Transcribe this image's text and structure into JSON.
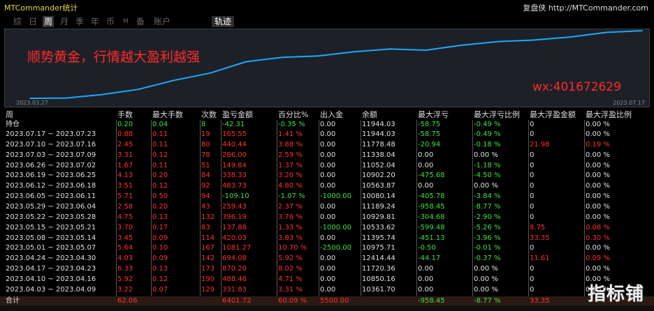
{
  "app_title": "MTCommander统计",
  "brand_right": "复盘侠 http://MTCommander.com",
  "tabs": [
    "综",
    "日",
    "周",
    "月",
    "季",
    "年",
    "币",
    "M",
    "备",
    "账户"
  ],
  "active_tab": "周",
  "trade_tab": "轨迹",
  "chart": {
    "slogan": "顺势黄金，行情越大盈利越强",
    "wx": "wx:401672629",
    "date_start": "2023.03.27",
    "date_end": "2023.07.17",
    "line_color": "#1ea7ff"
  },
  "chart_data": {
    "type": "line",
    "x": [
      "2023.03.27",
      "2023.04.03",
      "2023.04.10",
      "2023.04.17",
      "2023.04.24",
      "2023.05.01",
      "2023.05.08",
      "2023.05.15",
      "2023.05.22",
      "2023.05.29",
      "2023.06.05",
      "2023.06.12",
      "2023.06.19",
      "2023.06.26",
      "2023.07.03",
      "2023.07.10",
      "2023.07.17"
    ],
    "values": [
      10000.0,
      10029.87,
      10361.7,
      10850.16,
      11720.36,
      12414.44,
      10975.71,
      11395.74,
      10533.62,
      10929.81,
      11189.24,
      10080.14,
      10563.87,
      10902.2,
      11052.04,
      11338.04,
      11778.48
    ],
    "xlabel": "",
    "ylabel": ""
  },
  "table": {
    "headers": [
      "周",
      "手数",
      "最大手数",
      "次数",
      "盈亏金额",
      "百分比%",
      "出入金",
      "余额",
      "最大浮亏",
      "最大浮亏比例",
      "最大浮盈金额",
      "最大浮盈比例"
    ],
    "open": [
      "持仓",
      "0.20",
      "0.04",
      "8",
      "-42.31",
      "-0.35 %",
      "0.00",
      "11944.03",
      "-58.75",
      "-0.49 %",
      "0",
      "0.00 %"
    ],
    "rows": [
      [
        "2023.07.17 ~ 2023.07.23",
        "0.88",
        "0.11",
        "19",
        "165.55",
        "1.41 %",
        "0.00",
        "11944.03",
        "-58.75",
        "-0.49 %",
        "0",
        "0.00 %"
      ],
      [
        "2023.07.10 ~ 2023.07.16",
        "2.45",
        "0.11",
        "80",
        "440.44",
        "3.88 %",
        "0.00",
        "11778.48",
        "-20.94",
        "-0.18 %",
        "21.98",
        "0.19 %"
      ],
      [
        "2023.07.03 ~ 2023.07.09",
        "3.31",
        "0.12",
        "78",
        "286.00",
        "2.59 %",
        "0.00",
        "11338.04",
        "0.00",
        "0.00 %",
        "0",
        "0.00 %"
      ],
      [
        "2023.06.26 ~ 2023.07.02",
        "1.67",
        "0.11",
        "51",
        "149.84",
        "1.37 %",
        "0.00",
        "11052.04",
        "0.00",
        "-1.18 %",
        "0",
        "0.00 %"
      ],
      [
        "2023.06.19 ~ 2023.06.25",
        "4.13",
        "0.20",
        "84",
        "338.33",
        "3.20 %",
        "0.00",
        "10902.20",
        "-475.68",
        "-4.50 %",
        "0",
        "0.00 %"
      ],
      [
        "2023.06.12 ~ 2023.06.18",
        "3.51",
        "0.12",
        "92",
        "483.73",
        "4.80 %",
        "0.00",
        "10563.87",
        "0.00",
        "0.00 %",
        "0",
        "0.00 %"
      ],
      [
        "2023.06.05 ~ 2023.06.11",
        "5.71",
        "0.50",
        "94",
        "-109.10",
        "-1.07 %",
        "-1000.00",
        "10080.14",
        "-405.78",
        "-3.84 %",
        "0",
        "0.00 %"
      ],
      [
        "2023.05.29 ~ 2023.06.04",
        "2.58",
        "0.20",
        "43",
        "259.43",
        "2.37 %",
        "0.00",
        "11189.24",
        "-958.45",
        "-8.77 %",
        "0",
        "0.00 %"
      ],
      [
        "2023.05.22 ~ 2023.05.28",
        "4.75",
        "0.13",
        "132",
        "396.19",
        "3.76 %",
        "0.00",
        "10929.81",
        "-304.68",
        "-2.90 %",
        "0",
        "0.00 %"
      ],
      [
        "2023.05.15 ~ 2023.05.21",
        "3.70",
        "0.17",
        "83",
        "137.88",
        "1.33 %",
        "-1000.00",
        "10533.62",
        "-599.48",
        "-5.26 %",
        "8.75",
        "0.08 %"
      ],
      [
        "2023.05.08 ~ 2023.05.14",
        "3.45",
        "0.09",
        "114",
        "420.03",
        "3.83 %",
        "0.00",
        "11395.74",
        "-451.13",
        "-3.96 %",
        "33.35",
        "0.30 %"
      ],
      [
        "2023.05.01 ~ 2023.05.07",
        "5.64",
        "0.10",
        "167",
        "1081.27",
        "10.70 %",
        "-2500.00",
        "10975.71",
        "-0.50",
        "-0.01 %",
        "0",
        "0.00 %"
      ],
      [
        "2023.04.24 ~ 2023.04.30",
        "4.03",
        "0.09",
        "142",
        "694.08",
        "5.92 %",
        "0.00",
        "12414.44",
        "-44.17",
        "-0.37 %",
        "11.61",
        "0.09 %"
      ],
      [
        "2023.04.17 ~ 2023.04.23",
        "6.33",
        "0.13",
        "173",
        "870.20",
        "8.02 %",
        "0.00",
        "11720.36",
        "0.00",
        "0.00 %",
        "0",
        "0.00 %"
      ],
      [
        "2023.04.10 ~ 2023.04.16",
        "5.92",
        "0.12",
        "190",
        "488.46",
        "4.71 %",
        "0.00",
        "10850.16",
        "0.00",
        "0.00 %",
        "0",
        "0.00 %"
      ],
      [
        "2023.04.03 ~ 2023.04.09",
        "3.22",
        "0.07",
        "129",
        "331.83",
        "3.31 %",
        "0.00",
        "10361.70",
        "0.00",
        "0.00 %",
        "0",
        "0.00 %"
      ],
      [
        "2023.03.27 ~ 2023.04.02",
        "0.58",
        "0.08",
        "17",
        "29.87",
        "0.30 %",
        "10000.00",
        "10029.87",
        "0.00",
        "0.00 %",
        "0",
        "0.00 %"
      ]
    ],
    "total": [
      "合计",
      "62.06",
      "",
      "",
      "6401.72",
      "60.09 %",
      "5500.00",
      "",
      "-958.45",
      "-8.77 %",
      "33.35",
      ""
    ]
  },
  "watermark": "指标铺",
  "colors": {
    "positive": "#ff3030",
    "negative": "#40e040",
    "neutral": "#e0e0e0",
    "title": "#e8d54a"
  }
}
